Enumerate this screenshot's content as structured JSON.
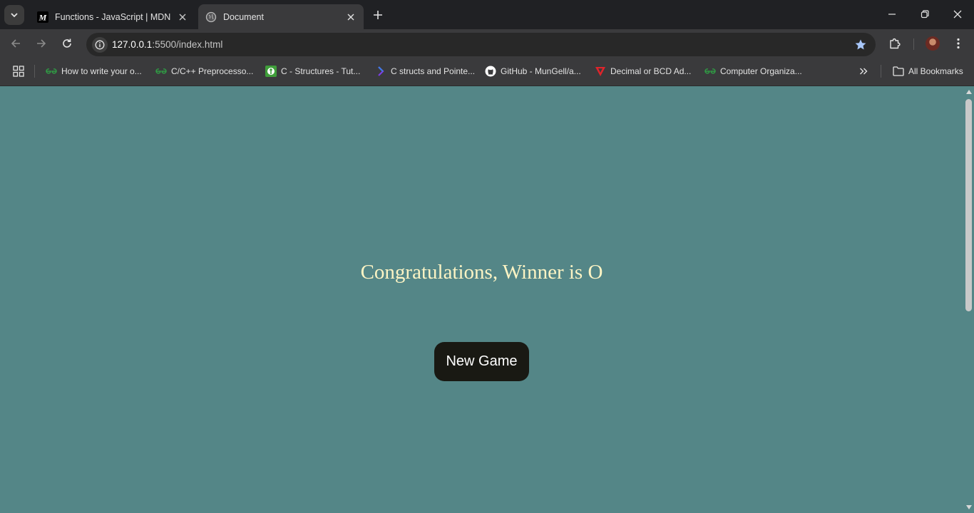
{
  "tabs": [
    {
      "title": "Functions - JavaScript | MDN",
      "icon": "mdn-icon"
    },
    {
      "title": "Document",
      "icon": "globe-icon",
      "active": true
    }
  ],
  "address": {
    "host": "127.0.0.1",
    "path": ":5500/index.html"
  },
  "bookmarks": [
    {
      "label": "How to write your o...",
      "icon": "geeksforgeeks-icon"
    },
    {
      "label": "C/C++ Preprocesso...",
      "icon": "geeksforgeeks-icon"
    },
    {
      "label": "C - Structures - Tut...",
      "icon": "tutorialspoint-icon"
    },
    {
      "label": "C structs and Pointe...",
      "icon": "programiz-icon"
    },
    {
      "label": "GitHub - MunGell/a...",
      "icon": "github-icon"
    },
    {
      "label": "Decimal or BCD Ad...",
      "icon": "bcd-icon"
    },
    {
      "label": "Computer Organiza...",
      "icon": "geeksforgeeks-icon"
    }
  ],
  "all_bookmarks_label": "All Bookmarks",
  "game": {
    "message": "Congratulations, Winner is O",
    "button_label": "New Game"
  },
  "colors": {
    "page_bg": "#548687",
    "message_text": "#fcf4c4",
    "button_bg": "#191913",
    "button_text": "#ffffff"
  }
}
